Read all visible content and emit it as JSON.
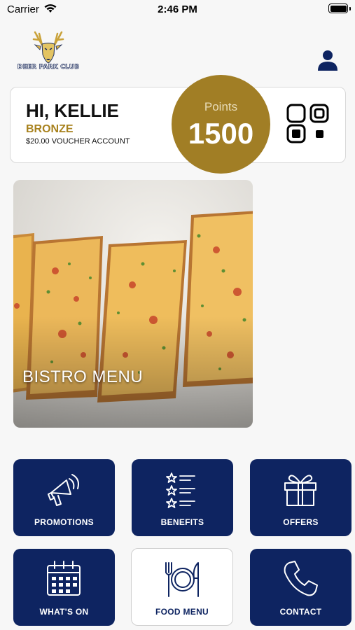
{
  "status_bar": {
    "carrier": "Carrier",
    "time": "2:46 PM"
  },
  "brand": {
    "logo_text": "DEER PARK CLUB",
    "logo_icon": "deer-head-logo",
    "navy": "#0e2461",
    "gold": "#a17e25"
  },
  "member": {
    "greeting": "HI, KELLIE",
    "tier": "BRONZE",
    "voucher": "$20.00 VOUCHER ACCOUNT",
    "points_label": "Points",
    "points_value": "1500"
  },
  "hero": {
    "label": "BISTRO MENU"
  },
  "tiles": [
    {
      "label": "PROMOTIONS",
      "icon": "megaphone-icon"
    },
    {
      "label": "BENEFITS",
      "icon": "star-list-icon"
    },
    {
      "label": "OFFERS",
      "icon": "gift-icon"
    },
    {
      "label": "WHAT'S ON",
      "icon": "calendar-icon"
    },
    {
      "label": "FOOD MENU",
      "icon": "plate-cutlery-icon"
    },
    {
      "label": "CONTACT",
      "icon": "phone-icon"
    }
  ]
}
